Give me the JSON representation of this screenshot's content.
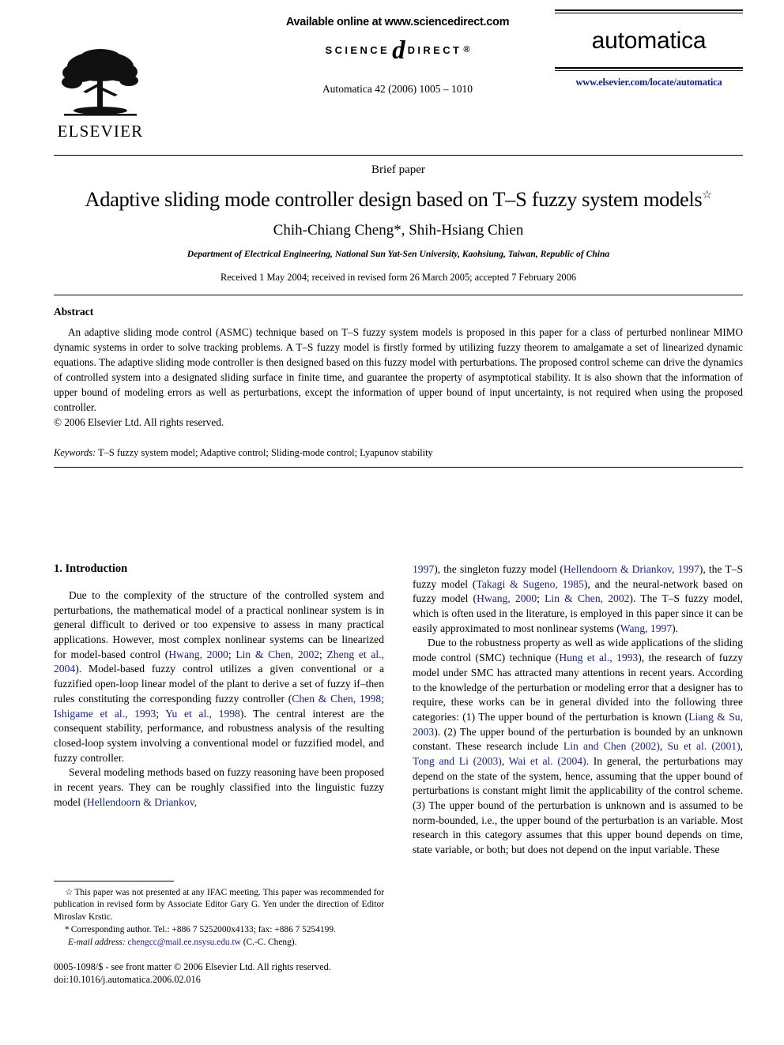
{
  "publisher": {
    "name": "ELSEVIER",
    "logo_icon": "elsevier-tree-logo"
  },
  "sciencedirect": {
    "available_text": "Available online at www.sciencedirect.com",
    "logo_left": "SCIENCE",
    "logo_at": "d",
    "logo_right": "DIRECT",
    "logo_reg": "®"
  },
  "journal": {
    "citation_line": "Automatica 42 (2006) 1005 – 1010",
    "name": "automatica",
    "url": "www.elsevier.com/locate/automatica"
  },
  "article": {
    "type_label": "Brief paper",
    "title": "Adaptive sliding mode controller design based on T–S fuzzy system models",
    "title_footnote_mark": "☆",
    "authors": "Chih-Chiang Cheng*, Shih-Hsiang Chien",
    "affiliation": "Department of Electrical Engineering, National Sun Yat-Sen University, Kaohsiung, Taiwan, Republic of China",
    "dates": "Received 1 May 2004; received in revised form 26 March 2005; accepted 7 February 2006"
  },
  "abstract": {
    "heading": "Abstract",
    "body": "An adaptive sliding mode control (ASMC) technique based on T–S fuzzy system models is proposed in this paper for a class of perturbed nonlinear MIMO dynamic systems in order to solve tracking problems. A T–S fuzzy model is firstly formed by utilizing fuzzy theorem to amalgamate a set of linearized dynamic equations. The adaptive sliding mode controller is then designed based on this fuzzy model with perturbations. The proposed control scheme can drive the dynamics of controlled system into a designated sliding surface in finite time, and guarantee the property of asymptotical stability. It is also shown that the information of upper bound of modeling errors as well as perturbations, except the information of upper bound of input uncertainty, is not required when using the proposed controller.",
    "copyright": "© 2006 Elsevier Ltd. All rights reserved."
  },
  "keywords": {
    "label": "Keywords:",
    "value": "T–S fuzzy system model; Adaptive control; Sliding-mode control; Lyapunov stability"
  },
  "section": {
    "number_title": "1.  Introduction"
  },
  "body_left": {
    "p1_a": "Due to the complexity of the structure of the controlled system and perturbations, the mathematical model of a practical nonlinear system is in general difficult to derived or too expensive to assess in many practical applications. However, most complex nonlinear systems can be linearized for model-based control (",
    "p1_cite1": "Hwang, 2000",
    "p1_b": "; ",
    "p1_cite2": "Lin & Chen, 2002",
    "p1_c": "; ",
    "p1_cite3": "Zheng et al., 2004",
    "p1_d": "). Model-based fuzzy control utilizes a given conventional or a fuzzified open-loop linear model of the plant to derive a set of fuzzy if–then rules constituting the corresponding fuzzy controller (",
    "p1_cite4": "Chen & Chen, 1998",
    "p1_e": "; ",
    "p1_cite5": "Ishigame et al., 1993",
    "p1_f": "; ",
    "p1_cite6": "Yu et al., 1998",
    "p1_g": "). The central interest are the consequent stability, performance, and robustness analysis of the resulting closed-loop system involving a conventional model or fuzzified model, and fuzzy controller.",
    "p2_a": "Several modeling methods based on fuzzy reasoning have been proposed in recent years. They can be roughly classified into the linguistic fuzzy model (",
    "p2_cite1": "Hellendoorn & Driankov,"
  },
  "body_right": {
    "p2_cont_cite": "1997",
    "p2_cont_a": "), the singleton fuzzy model (",
    "p2_cont_cite2": "Hellendoorn & Driankov, 1997",
    "p2_cont_b": "), the T–S fuzzy model (",
    "p2_cont_cite3": "Takagi & Sugeno, 1985",
    "p2_cont_c": "), and the neural-network based on fuzzy model (",
    "p2_cont_cite4": "Hwang, 2000",
    "p2_cont_d": "; ",
    "p2_cont_cite5": "Lin & Chen, 2002",
    "p2_cont_e": "). The T–S fuzzy model, which is often used in the literature, is employed in this paper since it can be easily approximated to most nonlinear systems (",
    "p2_cont_cite6": "Wang, 1997",
    "p2_cont_f": ").",
    "p3_a": "Due to the robustness property as well as wide applications of the sliding mode control (SMC) technique (",
    "p3_cite1": "Hung et al., 1993",
    "p3_b": "), the research of fuzzy model under SMC has attracted many attentions in recent years. According to the knowledge of the perturbation or modeling error that a designer has to require, these works can be in general divided into the following three categories: (1) The upper bound of the perturbation is known (",
    "p3_cite2": "Liang & Su, 2003",
    "p3_c": "). (2) The upper bound of the perturbation is bounded by an unknown constant. These research include ",
    "p3_cite3": "Lin and Chen (2002)",
    "p3_d": ", ",
    "p3_cite4": "Su et al. (2001)",
    "p3_e": ", ",
    "p3_cite5": "Tong and Li (2003)",
    "p3_f": ", ",
    "p3_cite6": "Wai et al. (2004)",
    "p3_g": ". In general, the perturbations may depend on the state of the system, hence, assuming that the upper bound of perturbations is constant might limit the applicability of the control scheme. (3) The upper bound of the perturbation is unknown and is assumed to be norm-bounded, i.e., the upper bound of the perturbation is an variable. Most research in this category assumes that this upper bound depends on time, state variable, or both; but does not depend on the input variable. These"
  },
  "footnotes": {
    "star_mark": "☆",
    "star_text": "This paper was not presented at any IFAC meeting. This paper was recommended for publication in revised form by Associate Editor Gary G. Yen under the direction of Editor Miroslav Krstic.",
    "asterisk_mark": "*",
    "asterisk_text": "Corresponding author. Tel.: +886 7 5252000x4133; fax: +886 7 5254199.",
    "email_label": "E-mail address:",
    "email_value": "chengcc@mail.ee.nsysu.edu.tw",
    "email_suffix": "(C.-C. Cheng)."
  },
  "imprint": {
    "issn_line": "0005-1098/$ - see front matter © 2006 Elsevier Ltd. All rights reserved.",
    "doi_line": "doi:10.1016/j.automatica.2006.02.016"
  },
  "colors": {
    "citation_blue": "#1a237e",
    "text_black": "#000000",
    "page_background": "#ffffff"
  }
}
